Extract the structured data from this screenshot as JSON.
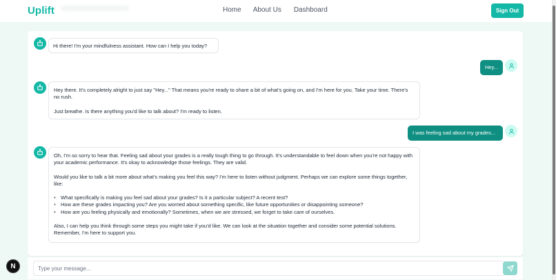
{
  "header": {
    "logo": "Uplift",
    "nav": [
      "Home",
      "About Us",
      "Dashboard"
    ],
    "sign_out": "Sign Out"
  },
  "messages": {
    "m1": "Hi there! I'm your mindfulness assistant. How can I help you today?",
    "m2": "Hey...",
    "m3_p1": "Hey there. It's completely alright to just say \"Hey...\" That means you're ready to share a bit of what's going on, and I'm here for you. Take your time. There's no rush.",
    "m3_p2": "Just breathe. Is there anything you'd like to talk about? I'm ready to listen.",
    "m4": "I was feeling sad about my grades...",
    "m5_p1": "Oh, I'm so sorry to hear that. Feeling sad about your grades is a really tough thing to go through. It's understandable to feel down when you're not happy with your academic performance. It's okay to acknowledge those feelings. They are valid.",
    "m5_p2": "Would you like to talk a bit more about what's making you feel this way? I'm here to listen without judgment. Perhaps we can explore some things together, like:",
    "m5_bullets": [
      "What specifically is making you feel sad about your grades? Is it a particular subject? A recent test?",
      "How are these grades impacting you? Are you worried about something specific, like future opportunities or disappointing someone?",
      "How are you feeling physically and emotionally? Sometimes, when we are stressed, we forget to take care of ourselves."
    ],
    "m5_p3": "Also, I can help you think through some steps you might take if you'd like. We can look at the situation together and consider some potential solutions. Remember, I'm here to support you."
  },
  "input": {
    "placeholder": "Type your message...",
    "value": ""
  },
  "footer": {
    "badge": "N"
  },
  "colors": {
    "brand": "#14b8a6",
    "user_bubble": "#0f8f82",
    "user_avatar": "#ccfbf1",
    "background": "#eef8f5"
  },
  "icons": {
    "bot_avatar": "bot-icon",
    "user_avatar": "user-icon",
    "send": "send-icon"
  }
}
